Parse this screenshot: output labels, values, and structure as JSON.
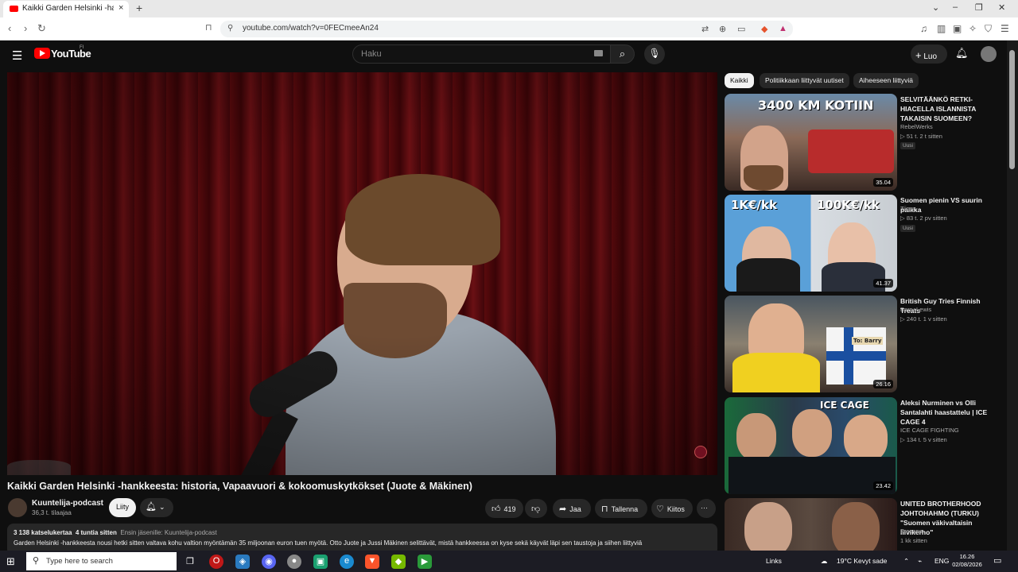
{
  "browser": {
    "tab_title": "Kaikki Garden Helsinki -hank",
    "url": "youtube.com/watch?v=0FECmeeAn24",
    "new_tab": "+",
    "tab_close": "×"
  },
  "youtube": {
    "logo_text": "YouTube",
    "logo_country": "FI",
    "search_placeholder": "Haku",
    "create_label": "Luo"
  },
  "video": {
    "title": "Kaikki Garden Helsinki -hankkeesta: historia, Vapaavuori & kokoomuskytkökset (Juote & Mäkinen)",
    "channel": "Kuuntelija-podcast",
    "subscribers": "36,3 t. tilaajaa",
    "join_label": "Liity",
    "likes": "419",
    "share_label": "Jaa",
    "save_label": "Tallenna",
    "thanks_label": "Kiitos",
    "more_label": "···"
  },
  "description": {
    "views": "3 138 katselukertaa",
    "time": "4 tuntia sitten",
    "members": "Ensin jäsenille: Kuuntelija-podcast",
    "text": "Garden Helsinki -hankkeesta nousi hetki sitten valtava kohu valtion myöntämän 35 miljoonan euron tuen myötä. Otto Juote ja Jussi Mäkinen selittävät, mistä hankkeessa on kyse sekä käyvät läpi sen taustoja ja siihen liittyviä"
  },
  "chips": [
    "Kaikki",
    "Politiikkaan liittyvät uutiset",
    "Aiheeseen liittyviä"
  ],
  "recommendations": [
    {
      "title": "SELVITÄÄNKÖ RETKI-HIACELLA ISLANNISTA TAKAISIN SUOMEEN?",
      "channel": "RebelWerks",
      "stats": "▷ 51 t.   2 t sitten",
      "badge": "Uusi",
      "duration": "35.04",
      "thumb_text": "3400 KM KOTIIN"
    },
    {
      "title": "Suomen pienin VS suurin palkka",
      "channel": "Tiirus",
      "stats": "▷ 83 t.   2 pv sitten",
      "badge": "Uusi",
      "duration": "41.37",
      "thumb_text_left": "1K€/kk",
      "thumb_text_right": "100K€/kk"
    },
    {
      "title": "British Guy Tries Finnish Treats",
      "channel": "Barry Lewis",
      "stats": "▷ 240 t.   1 v sitten",
      "badge": "",
      "duration": "26.16",
      "thumb_text": "To: Barry"
    },
    {
      "title": "Aleksi Nurminen vs Olli Santalahti haastattelu | ICE CAGE 4",
      "channel": "ICE CAGE FIGHTING",
      "stats": "▷ 134 t.   5 v sitten",
      "badge": "",
      "duration": "23.42",
      "thumb_text": "ICE CAGE"
    },
    {
      "title": "UNITED BROTHERHOOD JOHTOHAHMO (TURKU) \"Suomen väkivaltaisin liivikerho\"",
      "channel": "Freeope",
      "stats": "1 kk sitten",
      "badge": "",
      "duration": "",
      "thumb_text": ""
    }
  ],
  "taskbar": {
    "search_placeholder": "Type here to search",
    "links": "Links",
    "weather": "19°C  Kevyt sade",
    "lang": "ENG",
    "time": "16.26",
    "date": "02/08/2026"
  },
  "colors": {
    "yt_red": "#ff0000",
    "bg": "#0f0f0f",
    "chip_bg": "#272727"
  }
}
